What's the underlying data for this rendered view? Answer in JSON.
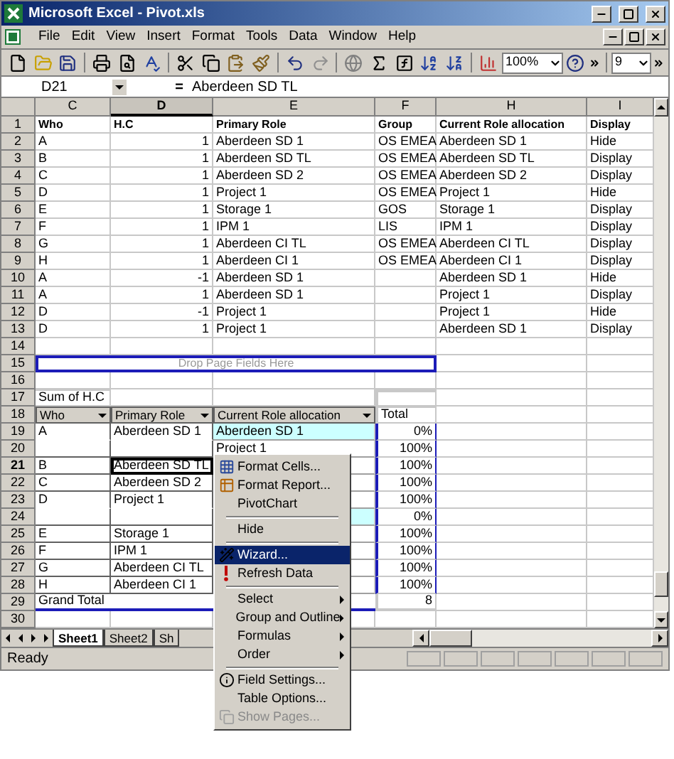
{
  "window": {
    "title": "Microsoft Excel - Pivot.xls"
  },
  "menu_bar": [
    "File",
    "Edit",
    "View",
    "Insert",
    "Format",
    "Tools",
    "Data",
    "Window",
    "Help"
  ],
  "toolbar": {
    "zoom": "100%",
    "font_size": "9"
  },
  "formula_bar": {
    "cell_ref": "D21",
    "equals": "=",
    "value": "Aberdeen SD TL"
  },
  "columns": [
    {
      "label": "C",
      "selected": false
    },
    {
      "label": "D",
      "selected": true
    },
    {
      "label": "E",
      "selected": false
    },
    {
      "label": "F",
      "selected": false
    },
    {
      "label": "H",
      "selected": false
    },
    {
      "label": "I",
      "selected": false
    }
  ],
  "rows": [
    {
      "number": "1",
      "selected": false,
      "kind": "header",
      "labels": [
        "Who",
        "H.C",
        "Primary Role",
        "Group",
        "Current Role allocation",
        "Display"
      ]
    },
    {
      "number": "2",
      "selected": false,
      "kind": "data",
      "who": "A",
      "hc": "1",
      "primary_role": "Aberdeen SD 1",
      "group": "OS EMEA",
      "current_role": "Aberdeen SD 1",
      "display": "Hide"
    },
    {
      "number": "3",
      "selected": false,
      "kind": "data",
      "who": "B",
      "hc": "1",
      "primary_role": "Aberdeen SD TL",
      "group": "OS EMEA",
      "current_role": "Aberdeen SD TL",
      "display": "Display"
    },
    {
      "number": "4",
      "selected": false,
      "kind": "data",
      "who": "C",
      "hc": "1",
      "primary_role": "Aberdeen SD 2",
      "group": "OS EMEA",
      "current_role": "Aberdeen SD 2",
      "display": "Display"
    },
    {
      "number": "5",
      "selected": false,
      "kind": "data",
      "who": "D",
      "hc": "1",
      "primary_role": "Project 1",
      "group": "OS EMEA",
      "current_role": "Project 1",
      "display": "Hide"
    },
    {
      "number": "6",
      "selected": false,
      "kind": "data",
      "who": "E",
      "hc": "1",
      "primary_role": "Storage 1",
      "group": "GOS",
      "current_role": "Storage 1",
      "display": "Display"
    },
    {
      "number": "7",
      "selected": false,
      "kind": "data",
      "who": "F",
      "hc": "1",
      "primary_role": "IPM 1",
      "group": "LIS",
      "current_role": "IPM 1",
      "display": "Display"
    },
    {
      "number": "8",
      "selected": false,
      "kind": "data",
      "who": "G",
      "hc": "1",
      "primary_role": "Aberdeen CI TL",
      "group": "OS EMEA",
      "current_role": "Aberdeen CI TL",
      "display": "Display"
    },
    {
      "number": "9",
      "selected": false,
      "kind": "data",
      "who": "H",
      "hc": "1",
      "primary_role": "Aberdeen CI 1",
      "group": "OS EMEA",
      "current_role": "Aberdeen CI 1",
      "display": "Display"
    },
    {
      "number": "10",
      "selected": false,
      "kind": "data",
      "who": "A",
      "hc": "-1",
      "primary_role": "Aberdeen SD 1",
      "current_role": "Aberdeen SD 1",
      "display": "Hide"
    },
    {
      "number": "11",
      "selected": false,
      "kind": "data",
      "who": "A",
      "hc": "1",
      "primary_role": "Aberdeen SD 1",
      "current_role": "Project 1",
      "display": "Display"
    },
    {
      "number": "12",
      "selected": false,
      "kind": "data",
      "who": "D",
      "hc": "-1",
      "primary_role": "Project 1",
      "current_role": "Project 1",
      "display": "Hide"
    },
    {
      "number": "13",
      "selected": false,
      "kind": "data",
      "who": "D",
      "hc": "1",
      "primary_role": "Project 1",
      "current_role": "Aberdeen SD 1",
      "display": "Display"
    },
    {
      "number": "14",
      "selected": false,
      "kind": "blank"
    },
    {
      "number": "15",
      "selected": false,
      "kind": "drop_zone",
      "text": "Drop Page Fields Here"
    },
    {
      "number": "16",
      "selected": false,
      "kind": "blank"
    },
    {
      "number": "17",
      "selected": false,
      "kind": "pivot_data_field",
      "text": "Sum of H.C"
    },
    {
      "number": "18",
      "selected": false,
      "kind": "pivot_fields",
      "fields": [
        "Who",
        "Primary Role",
        "Current Role allocation"
      ],
      "total_label": "Total"
    },
    {
      "number": "19",
      "selected": false,
      "kind": "pivot_row",
      "who": "A",
      "primary_role": "Aberdeen SD 1",
      "current_role": "Aberdeen SD 1",
      "total": "0%",
      "highlighted": true
    },
    {
      "number": "20",
      "selected": false,
      "kind": "pivot_row",
      "current_role": "Project 1",
      "total": "100%",
      "highlighted": false
    },
    {
      "number": "21",
      "selected": true,
      "kind": "pivot_row",
      "who": "B",
      "primary_role": "Aberdeen SD TL",
      "total": "100%",
      "highlighted": false
    },
    {
      "number": "22",
      "selected": false,
      "kind": "pivot_row",
      "who": "C",
      "primary_role": "Aberdeen SD 2",
      "total": "100%",
      "highlighted": false
    },
    {
      "number": "23",
      "selected": false,
      "kind": "pivot_row",
      "who": "D",
      "primary_role": "Project 1",
      "total": "100%",
      "highlighted": false
    },
    {
      "number": "24",
      "selected": false,
      "kind": "pivot_row",
      "total": "0%",
      "highlighted": true
    },
    {
      "number": "25",
      "selected": false,
      "kind": "pivot_row",
      "who": "E",
      "primary_role": "Storage 1",
      "total": "100%",
      "highlighted": false
    },
    {
      "number": "26",
      "selected": false,
      "kind": "pivot_row",
      "who": "F",
      "primary_role": "IPM 1",
      "total": "100%",
      "highlighted": false
    },
    {
      "number": "27",
      "selected": false,
      "kind": "pivot_row",
      "who": "G",
      "primary_role": "Aberdeen CI TL",
      "total": "100%",
      "highlighted": false
    },
    {
      "number": "28",
      "selected": false,
      "kind": "pivot_row",
      "who": "H",
      "primary_role": "Aberdeen CI 1",
      "total": "100%",
      "highlighted": false
    },
    {
      "number": "29",
      "selected": false,
      "kind": "grand_total",
      "label": "Grand Total",
      "total": "8"
    },
    {
      "number": "30",
      "selected": false,
      "kind": "blank"
    }
  ],
  "sheet_tabs": [
    {
      "label": "Sheet1",
      "selected": true
    },
    {
      "label": "Sheet2",
      "selected": false
    },
    {
      "label": "Sh",
      "selected": false
    }
  ],
  "status_bar": {
    "text": "Ready"
  },
  "context_menu": [
    {
      "kind": "item",
      "label": "Format Cells...",
      "selected": false,
      "disabled": false
    },
    {
      "kind": "item",
      "label": "Format Report...",
      "selected": false,
      "disabled": false
    },
    {
      "kind": "item",
      "label": "PivotChart",
      "selected": false,
      "disabled": false
    },
    {
      "kind": "separator"
    },
    {
      "kind": "item",
      "label": "Hide",
      "selected": false,
      "disabled": false
    },
    {
      "kind": "separator"
    },
    {
      "kind": "item",
      "label": "Wizard...",
      "selected": true,
      "disabled": false
    },
    {
      "kind": "item",
      "label": "Refresh Data",
      "selected": false,
      "disabled": false
    },
    {
      "kind": "separator"
    },
    {
      "kind": "submenu",
      "label": "Select",
      "selected": false,
      "disabled": false
    },
    {
      "kind": "submenu",
      "label": "Group and Outline",
      "selected": false,
      "disabled": false
    },
    {
      "kind": "submenu",
      "label": "Formulas",
      "selected": false,
      "disabled": false
    },
    {
      "kind": "submenu",
      "label": "Order",
      "selected": false,
      "disabled": false
    },
    {
      "kind": "separator"
    },
    {
      "kind": "item",
      "label": "Field Settings...",
      "selected": false,
      "disabled": false
    },
    {
      "kind": "item",
      "label": "Table Options...",
      "selected": false,
      "disabled": false
    },
    {
      "kind": "item",
      "label": "Show Pages...",
      "selected": false,
      "disabled": true
    }
  ]
}
